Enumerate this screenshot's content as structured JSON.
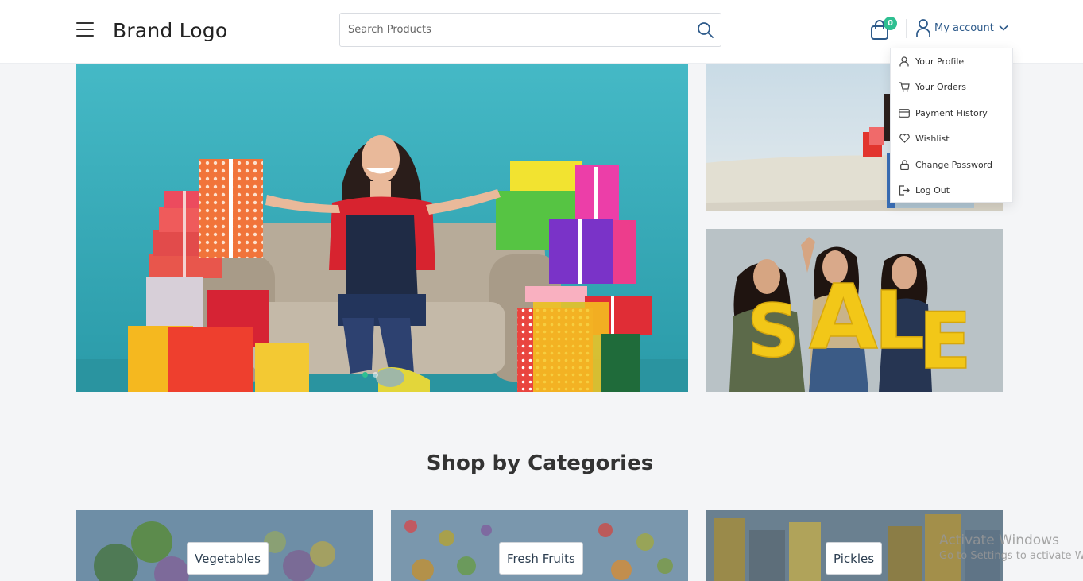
{
  "header": {
    "brand": "Brand Logo",
    "search": {
      "placeholder": "Search Products",
      "value": ""
    },
    "cart": {
      "count": "0",
      "icon": "shopping-bag-icon"
    },
    "account": {
      "label": "My account",
      "icon": "user-icon"
    }
  },
  "account_menu": {
    "items": [
      {
        "label": "Your Profile",
        "icon": "user-icon"
      },
      {
        "label": "Your Orders",
        "icon": "cart-icon"
      },
      {
        "label": "Payment History",
        "icon": "credit-card-icon"
      },
      {
        "label": "Wishlist",
        "icon": "heart-icon"
      },
      {
        "label": "Change Password",
        "icon": "lock-icon"
      },
      {
        "label": "Log Out",
        "icon": "logout-icon"
      }
    ]
  },
  "hero": {
    "slides": 2,
    "active_slide": 1,
    "promo_sale_text": "SALE"
  },
  "categories": {
    "title": "Shop by Categories",
    "items": [
      {
        "label": "Vegetables"
      },
      {
        "label": "Fresh Fruits"
      },
      {
        "label": "Pickles"
      }
    ]
  },
  "watermark": {
    "line1": "Activate Windows",
    "line2": "Go to Settings to activate Windows."
  },
  "colors": {
    "accent": "#2ebf91",
    "account_text": "#2d5a8a",
    "hero_bg": "#3eaebd",
    "sale_yellow": "#f2c718"
  }
}
